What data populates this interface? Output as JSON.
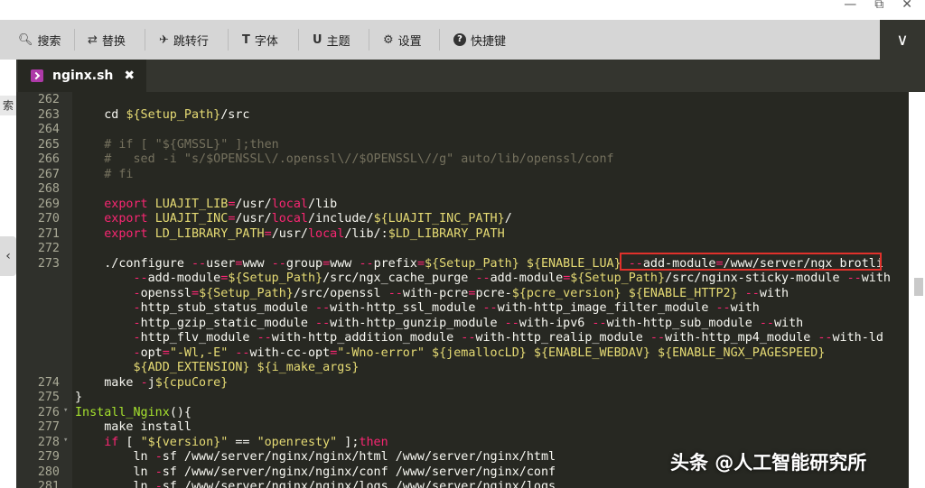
{
  "window": {
    "controls": [
      "—",
      "⧉",
      "✕"
    ]
  },
  "toolbar": {
    "items": [
      {
        "label": "搜索",
        "icon": "search-icon",
        "glyph": "🔍︎"
      },
      {
        "label": "替换",
        "icon": "replace-icon",
        "glyph": "⇄"
      },
      {
        "label": "跳转行",
        "icon": "goto-line-icon",
        "glyph": "✈"
      },
      {
        "label": "字体",
        "icon": "font-icon",
        "glyph": "T"
      },
      {
        "label": "主题",
        "icon": "theme-icon",
        "glyph": "U"
      },
      {
        "label": "设置",
        "icon": "gear-icon",
        "glyph": "⚙"
      },
      {
        "label": "快捷键",
        "icon": "help-icon",
        "glyph": "?"
      }
    ],
    "expand_glyph": "∨"
  },
  "left_strip": {
    "label": "索",
    "arrow": "‹"
  },
  "tab": {
    "name": "nginx.sh",
    "close": "✖",
    "icon": "shell-file-icon"
  },
  "editor": {
    "lines": [
      {
        "n": "262",
        "fold": "",
        "segs": []
      },
      {
        "n": "263",
        "fold": "",
        "segs": [
          {
            "t": "    cd ",
            "c": "p"
          },
          {
            "t": "${Setup_Path}",
            "c": "v"
          },
          {
            "t": "/src",
            "c": "p"
          }
        ]
      },
      {
        "n": "264",
        "fold": "",
        "segs": []
      },
      {
        "n": "265",
        "fold": "",
        "segs": [
          {
            "t": "    # if [ \"${GMSSL}\" ];then",
            "c": "c"
          }
        ]
      },
      {
        "n": "266",
        "fold": "",
        "segs": [
          {
            "t": "    #   sed -i \"s/$OPENSSL\\/.openssl\\//$OPENSSL\\//g\" auto/lib/openssl/conf",
            "c": "c"
          }
        ]
      },
      {
        "n": "267",
        "fold": "",
        "segs": [
          {
            "t": "    # fi",
            "c": "c"
          }
        ]
      },
      {
        "n": "268",
        "fold": "",
        "segs": []
      },
      {
        "n": "269",
        "fold": "",
        "segs": [
          {
            "t": "    export ",
            "c": "k"
          },
          {
            "t": "LUAJIT_LIB",
            "c": "v"
          },
          {
            "t": "=",
            "c": "o"
          },
          {
            "t": "/usr/",
            "c": "p"
          },
          {
            "t": "local",
            "c": "k"
          },
          {
            "t": "/lib",
            "c": "p"
          }
        ]
      },
      {
        "n": "270",
        "fold": "",
        "segs": [
          {
            "t": "    export ",
            "c": "k"
          },
          {
            "t": "LUAJIT_INC",
            "c": "v"
          },
          {
            "t": "=",
            "c": "o"
          },
          {
            "t": "/usr/",
            "c": "p"
          },
          {
            "t": "local",
            "c": "k"
          },
          {
            "t": "/include/",
            "c": "p"
          },
          {
            "t": "${LUAJIT_INC_PATH}",
            "c": "v"
          },
          {
            "t": "/",
            "c": "p"
          }
        ]
      },
      {
        "n": "271",
        "fold": "",
        "segs": [
          {
            "t": "    export ",
            "c": "k"
          },
          {
            "t": "LD_LIBRARY_PATH",
            "c": "v"
          },
          {
            "t": "=",
            "c": "o"
          },
          {
            "t": "/usr/",
            "c": "p"
          },
          {
            "t": "local",
            "c": "k"
          },
          {
            "t": "/lib/:",
            "c": "p"
          },
          {
            "t": "$LD_LIBRARY_PATH",
            "c": "v"
          }
        ]
      },
      {
        "n": "272",
        "fold": "",
        "segs": []
      },
      {
        "n": "273",
        "fold": "",
        "segs": [
          {
            "t": "    ./configure ",
            "c": "p"
          },
          {
            "t": "--",
            "c": "o"
          },
          {
            "t": "user",
            "c": "p"
          },
          {
            "t": "=",
            "c": "o"
          },
          {
            "t": "www ",
            "c": "p"
          },
          {
            "t": "--",
            "c": "o"
          },
          {
            "t": "group",
            "c": "p"
          },
          {
            "t": "=",
            "c": "o"
          },
          {
            "t": "www ",
            "c": "p"
          },
          {
            "t": "--",
            "c": "o"
          },
          {
            "t": "prefix",
            "c": "p"
          },
          {
            "t": "=",
            "c": "o"
          },
          {
            "t": "${Setup_Path} ${ENABLE_LUA}",
            "c": "v"
          },
          {
            "t": " --",
            "c": "o"
          },
          {
            "t": "add-module",
            "c": "p"
          },
          {
            "t": "=",
            "c": "o"
          },
          {
            "t": "/www/server/ngx_brotli",
            "c": "p"
          }
        ]
      },
      {
        "n": "",
        "fold": "",
        "segs": [
          {
            "t": "        --",
            "c": "o"
          },
          {
            "t": "add-module",
            "c": "p"
          },
          {
            "t": "=",
            "c": "o"
          },
          {
            "t": "${Setup_Path}",
            "c": "v"
          },
          {
            "t": "/src/ngx_cache_purge ",
            "c": "p"
          },
          {
            "t": "--",
            "c": "o"
          },
          {
            "t": "add-module",
            "c": "p"
          },
          {
            "t": "=",
            "c": "o"
          },
          {
            "t": "${Setup_Path}",
            "c": "v"
          },
          {
            "t": "/src/nginx-sticky-module ",
            "c": "p"
          },
          {
            "t": "--",
            "c": "o"
          },
          {
            "t": "with",
            "c": "p"
          }
        ]
      },
      {
        "n": "",
        "fold": "",
        "segs": [
          {
            "t": "        -",
            "c": "o"
          },
          {
            "t": "openssl",
            "c": "p"
          },
          {
            "t": "=",
            "c": "o"
          },
          {
            "t": "${Setup_Path}",
            "c": "v"
          },
          {
            "t": "/src/openssl ",
            "c": "p"
          },
          {
            "t": "--",
            "c": "o"
          },
          {
            "t": "with-pcre",
            "c": "p"
          },
          {
            "t": "=",
            "c": "o"
          },
          {
            "t": "pcre-",
            "c": "p"
          },
          {
            "t": "${pcre_version} ${ENABLE_HTTP2}",
            "c": "v"
          },
          {
            "t": " --",
            "c": "o"
          },
          {
            "t": "with",
            "c": "p"
          }
        ]
      },
      {
        "n": "",
        "fold": "",
        "segs": [
          {
            "t": "        -",
            "c": "o"
          },
          {
            "t": "http_stub_status_module ",
            "c": "p"
          },
          {
            "t": "--",
            "c": "o"
          },
          {
            "t": "with-http_ssl_module ",
            "c": "p"
          },
          {
            "t": "--",
            "c": "o"
          },
          {
            "t": "with-http_image_filter_module ",
            "c": "p"
          },
          {
            "t": "--",
            "c": "o"
          },
          {
            "t": "with",
            "c": "p"
          }
        ]
      },
      {
        "n": "",
        "fold": "",
        "segs": [
          {
            "t": "        -",
            "c": "o"
          },
          {
            "t": "http_gzip_static_module ",
            "c": "p"
          },
          {
            "t": "--",
            "c": "o"
          },
          {
            "t": "with-http_gunzip_module ",
            "c": "p"
          },
          {
            "t": "--",
            "c": "o"
          },
          {
            "t": "with-ipv6 ",
            "c": "p"
          },
          {
            "t": "--",
            "c": "o"
          },
          {
            "t": "with-http_sub_module ",
            "c": "p"
          },
          {
            "t": "--",
            "c": "o"
          },
          {
            "t": "with",
            "c": "p"
          }
        ]
      },
      {
        "n": "",
        "fold": "",
        "segs": [
          {
            "t": "        -",
            "c": "o"
          },
          {
            "t": "http_flv_module ",
            "c": "p"
          },
          {
            "t": "--",
            "c": "o"
          },
          {
            "t": "with-http_addition_module ",
            "c": "p"
          },
          {
            "t": "--",
            "c": "o"
          },
          {
            "t": "with-http_realip_module ",
            "c": "p"
          },
          {
            "t": "--",
            "c": "o"
          },
          {
            "t": "with-http_mp4_module ",
            "c": "p"
          },
          {
            "t": "--",
            "c": "o"
          },
          {
            "t": "with-ld",
            "c": "p"
          }
        ]
      },
      {
        "n": "",
        "fold": "",
        "segs": [
          {
            "t": "        -",
            "c": "o"
          },
          {
            "t": "opt",
            "c": "p"
          },
          {
            "t": "=",
            "c": "o"
          },
          {
            "t": "\"-Wl,-E\"",
            "c": "s"
          },
          {
            "t": " --",
            "c": "o"
          },
          {
            "t": "with-cc-opt",
            "c": "p"
          },
          {
            "t": "=",
            "c": "o"
          },
          {
            "t": "\"-Wno-error\"",
            "c": "s"
          },
          {
            "t": " ${jemallocLD} ${ENABLE_WEBDAV} ${ENABLE_NGX_PAGESPEED}",
            "c": "v"
          }
        ]
      },
      {
        "n": "",
        "fold": "",
        "segs": [
          {
            "t": "        ${ADD_EXTENSION} ${i_make_args}",
            "c": "v"
          }
        ]
      },
      {
        "n": "274",
        "fold": "",
        "segs": [
          {
            "t": "    make ",
            "c": "p"
          },
          {
            "t": "-",
            "c": "o"
          },
          {
            "t": "j",
            "c": "p"
          },
          {
            "t": "${cpuCore}",
            "c": "v"
          }
        ]
      },
      {
        "n": "275",
        "fold": "",
        "segs": [
          {
            "t": "}",
            "c": "p"
          }
        ]
      },
      {
        "n": "276",
        "fold": "▾",
        "segs": [
          {
            "t": "Install_Nginx",
            "c": "f"
          },
          {
            "t": "(){",
            "c": "p"
          }
        ]
      },
      {
        "n": "277",
        "fold": "",
        "segs": [
          {
            "t": "    make install",
            "c": "p"
          }
        ]
      },
      {
        "n": "278",
        "fold": "▾",
        "segs": [
          {
            "t": "    if",
            "c": "k"
          },
          {
            "t": " [ ",
            "c": "p"
          },
          {
            "t": "\"${version}\"",
            "c": "s"
          },
          {
            "t": " == ",
            "c": "p"
          },
          {
            "t": "\"openresty\"",
            "c": "s"
          },
          {
            "t": " ];",
            "c": "p"
          },
          {
            "t": "then",
            "c": "k"
          }
        ]
      },
      {
        "n": "279",
        "fold": "",
        "segs": [
          {
            "t": "        ln ",
            "c": "p"
          },
          {
            "t": "-",
            "c": "o"
          },
          {
            "t": "sf /www/server/nginx/nginx/html /www/server/nginx/html",
            "c": "p"
          }
        ]
      },
      {
        "n": "280",
        "fold": "",
        "segs": [
          {
            "t": "        ln ",
            "c": "p"
          },
          {
            "t": "-",
            "c": "o"
          },
          {
            "t": "sf /www/server/nginx/nginx/conf /www/server/nginx/conf",
            "c": "p"
          }
        ]
      },
      {
        "n": "281",
        "fold": "",
        "segs": [
          {
            "t": "        ln ",
            "c": "p"
          },
          {
            "t": "-",
            "c": "o"
          },
          {
            "t": "sf /www/server/nginx/nginx/logs /www/server/nginx/logs",
            "c": "p"
          }
        ]
      }
    ]
  },
  "watermark": "头条 @人工智能研究所",
  "colors": {
    "editor_bg": "#272822",
    "keyword": "#f92672",
    "variable": "#e6db74",
    "comment": "#75715e",
    "function": "#a6e22e",
    "highlight_box": "#e0312b"
  }
}
